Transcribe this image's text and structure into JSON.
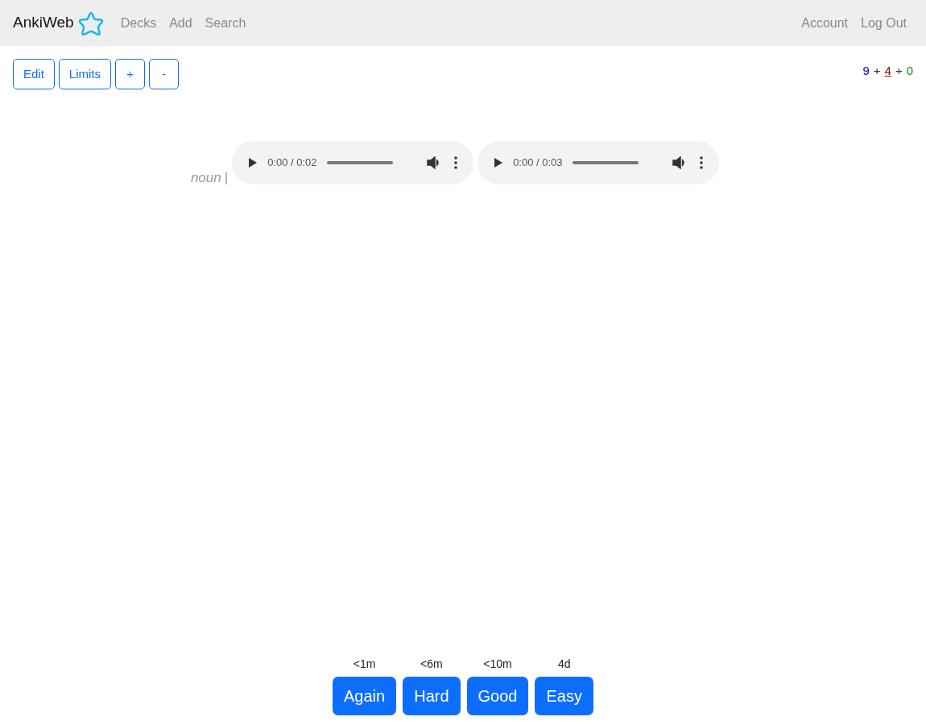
{
  "navbar": {
    "brand": "AnkiWeb",
    "links": [
      {
        "label": "Decks"
      },
      {
        "label": "Add"
      },
      {
        "label": "Search"
      }
    ],
    "right_links": [
      {
        "label": "Account"
      },
      {
        "label": "Log Out"
      }
    ]
  },
  "toolbar": {
    "buttons": [
      {
        "label": "Edit"
      },
      {
        "label": "Limits"
      },
      {
        "label": "+"
      },
      {
        "label": "-"
      }
    ]
  },
  "counts": [
    {
      "value": "9",
      "color": "#0000ff",
      "selected": false
    },
    {
      "value": "4",
      "color": "#990000",
      "selected": true
    },
    {
      "value": "0",
      "color": "#009900",
      "selected": false
    }
  ],
  "count_separators": [
    "+",
    "+"
  ],
  "card": {
    "part_of_speech": "noun",
    "separator": "|",
    "audio_players": [
      {
        "time": "0:00 / 0:02",
        "level": 0
      },
      {
        "time": "0:00 / 0:03",
        "level": 0
      }
    ]
  },
  "answer_buttons": [
    {
      "label": "Again",
      "interval": "<1m"
    },
    {
      "label": "Hard",
      "interval": "<6m"
    },
    {
      "label": "Good",
      "interval": "<10m"
    },
    {
      "label": "Easy",
      "interval": "4d"
    }
  ]
}
